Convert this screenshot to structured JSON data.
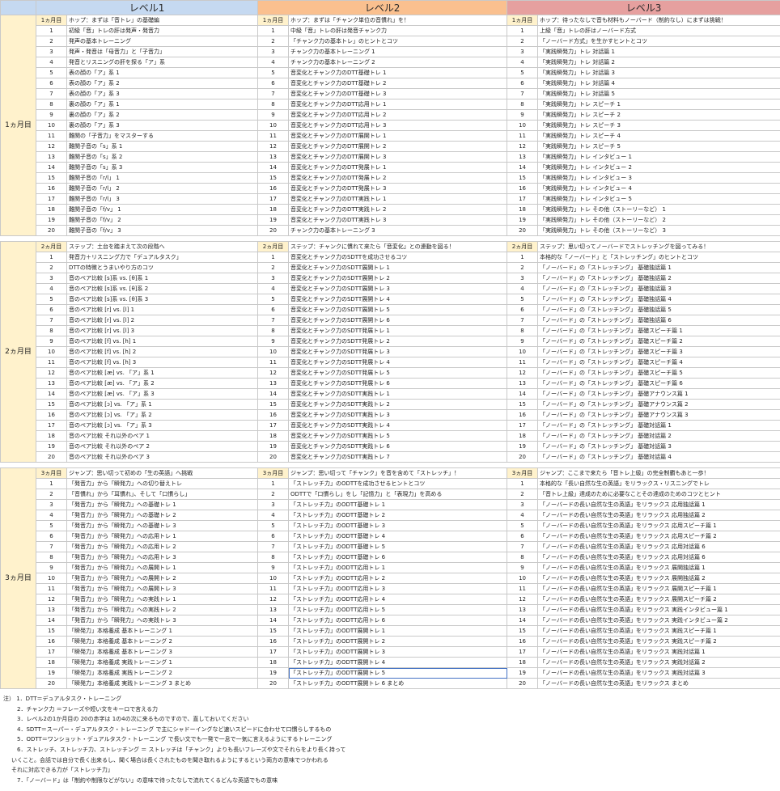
{
  "levels": [
    "レベル1",
    "レベル2",
    "レベル3"
  ],
  "sections": [
    {
      "month_label": "1ヵ月目",
      "cols": [
        {
          "month": "1ヵ月目",
          "title": "ホップ：まずは「音トレ」の基礎編",
          "items": [
            "初級「音」トレの肝は発声・発音力",
            "発声の基本トレーニング",
            "発声・発音は「母音力」と「子音力」",
            "発音とリスニングの肝を探る「ア」系",
            "表の顔の「ア」系 1",
            "表の顔の「ア」系 2",
            "表の顔の「ア」系 3",
            "裏の顔の「ア」系 1",
            "裏の顔の「ア」系 2",
            "裏の顔の「ア」系 3",
            "難関の「子音力」をマスターする",
            "難関子音の「s」系 1",
            "難関子音の「s」系 2",
            "難関子音の「s」系 3",
            "難関子音の「r/l」 1",
            "難関子音の「r/l」 2",
            "難関子音の「r/l」 3",
            "難関子音の「f/v」 1",
            "難関子音の「f/v」 2",
            "難関子音の「f/v」 3"
          ]
        },
        {
          "month": "1ヵ月目",
          "title": "ホップ：まずは「チャンク単位の音慣れ」を！",
          "items": [
            "中級「音」トレの肝は発音チャンク力",
            "「チャンク力の基本トレ」のヒントとコツ",
            "チャンク力の基本トレーニング 1",
            "チャンク力の基本トレーニング 2",
            "音変化とチャンク力のDTT基礎トレ 1",
            "音変化とチャンク力のDTT基礎トレ 2",
            "音変化とチャンク力のDTT基礎トレ 3",
            "音変化とチャンク力のDTT応用トレ 1",
            "音変化とチャンク力のDTT応用トレ 2",
            "音変化とチャンク力のDTT応用トレ 3",
            "音変化とチャンク力のDTT展開トレ 1",
            "音変化とチャンク力のDTT展開トレ 2",
            "音変化とチャンク力のDTT展開トレ 3",
            "音変化とチャンク力のDTT発展トレ 1",
            "音変化とチャンク力のDTT発展トレ 2",
            "音変化とチャンク力のDTT発展トレ 3",
            "音変化とチャンク力のDTT実践トレ 1",
            "音変化とチャンク力のDTT実践トレ 2",
            "音変化とチャンク力のDTT実践トレ 3",
            "チャンク力の基本トレーニング 3"
          ]
        },
        {
          "month": "1ヵ月目",
          "title": "ホップ：待ったなしで音も材料もノーバード（制約なし）にまずは挑戦！",
          "items": [
            "上級「音」トレの肝はノーバード方式",
            "「ノーバード方式」を生かすヒントとコツ",
            "「実践瞬発力」トレ 対話篇 1",
            "「実践瞬発力」トレ 対話篇 2",
            "「実践瞬発力」トレ 対話篇 3",
            "「実践瞬発力」トレ 対話篇 4",
            "「実践瞬発力」トレ 対話篇 5",
            "「実践瞬発力」トレ スピーチ 1",
            "「実践瞬発力」トレ スピーチ 2",
            "「実践瞬発力」トレ スピーチ 3",
            "「実践瞬発力」トレ スピーチ 4",
            "「実践瞬発力」トレ スピーチ 5",
            "「実践瞬発力」トレ インタビュー 1",
            "「実践瞬発力」トレ インタビュー 2",
            "「実践瞬発力」トレ インタビュー 3",
            "「実践瞬発力」トレ インタビュー 4",
            "「実践瞬発力」トレ インタビュー 5",
            "「実践瞬発力」トレ その他（ストーリーなど） 1",
            "「実践瞬発力」トレ その他（ストーリーなど） 2",
            "「実践瞬発力」トレ その他（ストーリーなど） 3"
          ]
        }
      ]
    },
    {
      "month_label": "2ヵ月目",
      "cols": [
        {
          "month": "2ヵ月目",
          "title": "ステップ：土台を踏まえて次の段階へ",
          "items": [
            "発音力＋リスニング力で「デュアルタスク」",
            "DTTの特徴とうまいやり方のコツ",
            "音のペア比較 [s]系 vs. [θ]系 1",
            "音のペア比較 [s]系 vs. [θ]系 2",
            "音のペア比較 [s]系 vs. [θ]系 3",
            "音のペア比較 [r] vs. [l] 1",
            "音のペア比較 [r] vs. [l] 2",
            "音のペア比較 [r] vs. [l] 3",
            "音のペア比較 [f] vs. [h] 1",
            "音のペア比較 [f] vs. [h] 2",
            "音のペア比較 [f] vs. [h] 3",
            "音のペア比較 [æ] vs. 「ア」系 1",
            "音のペア比較 [æ] vs. 「ア」系 2",
            "音のペア比較 [æ] vs. 「ア」系 3",
            "音のペア比較 [ɔ] vs. 「ア」系 1",
            "音のペア比較 [ɔ] vs. 「ア」系 2",
            "音のペア比較 [ɔ] vs. 「ア」系 3",
            "音のペア比較 それ以外のペア 1",
            "音のペア比較 それ以外のペア 2",
            "音のペア比較 それ以外のペア 3"
          ]
        },
        {
          "month": "2ヵ月目",
          "title": "ステップ：チャンクに慣れて来たら「音変化」との連動を図る！",
          "items": [
            "音変化とチャンク力のSDTTを成功させるコツ",
            "音変化とチャンク力のSDTT展開トレ 1",
            "音変化とチャンク力のSDTT展開トレ 2",
            "音変化とチャンク力のSDTT展開トレ 3",
            "音変化とチャンク力のSDTT展開トレ 4",
            "音変化とチャンク力のSDTT展開トレ 5",
            "音変化とチャンク力のSDTT展開トレ 6",
            "音変化とチャンク力のSDTT発展トレ 1",
            "音変化とチャンク力のSDTT発展トレ 2",
            "音変化とチャンク力のSDTT発展トレ 3",
            "音変化とチャンク力のSDTT発展トレ 4",
            "音変化とチャンク力のSDTT発展トレ 5",
            "音変化とチャンク力のSDTT発展トレ 6",
            "音変化とチャンク力のSDTT実践トレ 1",
            "音変化とチャンク力のSDTT実践トレ 2",
            "音変化とチャンク力のSDTT実践トレ 3",
            "音変化とチャンク力のSDTT実践トレ 4",
            "音変化とチャンク力のSDTT実践トレ 5",
            "音変化とチャンク力のSDTT実践トレ 6",
            "音変化とチャンク力のSDTT実践トレ 7"
          ]
        },
        {
          "month": "2ヵ月目",
          "title": "ステップ：思い切ってノーバードでストレッチングを図ってみる！",
          "items": [
            "本格的な「ノーバード」と「ストレッチング」のヒントとコツ",
            "「ノーバード」の「ストレッチング」 基礎独話篇 1",
            "「ノーバード」の「ストレッチング」 基礎独話篇 2",
            "「ノーバード」の「ストレッチング」 基礎独話篇 3",
            "「ノーバード」の「ストレッチング」 基礎独話篇 4",
            "「ノーバード」の「ストレッチング」 基礎独話篇 5",
            "「ノーバード」の「ストレッチング」 基礎独話篇 6",
            "「ノーバード」の「ストレッチング」 基礎スピーチ篇 1",
            "「ノーバード」の「ストレッチング」 基礎スピーチ篇 2",
            "「ノーバード」の「ストレッチング」 基礎スピーチ篇 3",
            "「ノーバード」の「ストレッチング」 基礎スピーチ篇 4",
            "「ノーバード」の「ストレッチング」 基礎スピーチ篇 5",
            "「ノーバード」の「ストレッチング」 基礎スピーチ篇 6",
            "「ノーバード」の「ストレッチング」 基礎アナウンス篇 1",
            "「ノーバード」の「ストレッチング」 基礎アナウンス篇 2",
            "「ノーバード」の「ストレッチング」 基礎アナウンス篇 3",
            "「ノーバード」の「ストレッチング」 基礎対話篇 1",
            "「ノーバード」の「ストレッチング」 基礎対話篇 2",
            "「ノーバード」の「ストレッチング」 基礎対話篇 3",
            "「ノーバード」の「ストレッチング」 基礎対話篇 4"
          ]
        }
      ]
    },
    {
      "month_label": "3ヵ月目",
      "cols": [
        {
          "month": "3ヵ月目",
          "title": "ジャンプ：思い切って初めの「生の英語」へ挑戦",
          "items": [
            "「発音力」から「瞬発力」への切り替えトレ",
            "「音慣れ」から「耳慣れ」、そして「口慣らし」",
            "「発音力」から「瞬発力」への基礎トレ 1",
            "「発音力」から「瞬発力」への基礎トレ 2",
            "「発音力」から「瞬発力」への基礎トレ 3",
            "「発音力」から「瞬発力」への応用トレ 1",
            "「発音力」から「瞬発力」への応用トレ 2",
            "「発音力」から「瞬発力」への応用トレ 3",
            "「発音力」から「瞬発力」への展開トレ 1",
            "「発音力」から「瞬発力」への展開トレ 2",
            "「発音力」から「瞬発力」への展開トレ 3",
            "「発音力」から「瞬発力」への実践トレ 1",
            "「発音力」から「瞬発力」への実践トレ 2",
            "「発音力」から「瞬発力」への実践トレ 3",
            "「瞬発力」本格養成 基本トレーニング 1",
            "「瞬発力」本格養成 基本トレーニング 2",
            "「瞬発力」本格養成 基本トレーニング 3",
            "「瞬発力」本格養成 実践トレーニング 1",
            "「瞬発力」本格養成 実践トレーニング 2",
            "「瞬発力」本格養成 実践トレーニング 3 まとめ"
          ]
        },
        {
          "month": "3ヵ月目",
          "title": "ジャンプ：思い切って「チャンク」を音を含めて「ストレッチ」！",
          "items": [
            "「ストレッチ力」のODTTを成功させるヒントとコツ",
            "ODTTで「口慣らし」をし「記憶力」と「表現力」を高める",
            "「ストレッチ力」のODTT基礎トレ 1",
            "「ストレッチ力」のODTT基礎トレ 2",
            "「ストレッチ力」のODTT基礎トレ 3",
            "「ストレッチ力」のODTT基礎トレ 4",
            "「ストレッチ力」のODTT基礎トレ 5",
            "「ストレッチ力」のODTT基礎トレ 6",
            "「ストレッチ力」のODTT応用トレ 1",
            "「ストレッチ力」のODTT応用トレ 2",
            "「ストレッチ力」のODTT応用トレ 3",
            "「ストレッチ力」のODTT応用トレ 4",
            "「ストレッチ力」のODTT応用トレ 5",
            "「ストレッチ力」のODTT応用トレ 6",
            "「ストレッチ力」のODTT展開トレ 1",
            "「ストレッチ力」のODTT展開トレ 2",
            "「ストレッチ力」のODTT展開トレ 3",
            "「ストレッチ力」のODTT展開トレ 4",
            "「ストレッチ力」のODTT展開トレ 5",
            "「ストレッチ力」のODTT展開トレ 6 まとめ"
          ]
        },
        {
          "month": "3ヵ月目",
          "title": "ジャンプ：ここまで来たら「音トレ上級」の完全制覇もあと一歩！",
          "items": [
            "本格的な「長い自然な生の英語」をリラックス・リスニングでトレ",
            "「音トレ上級」達成のために必要なことその達成のためのコツとヒント",
            "「ノーバードの長い自然な生の英語」をリラックス 応用独話篇 1",
            "「ノーバードの長い自然な生の英語」をリラックス 応用独話篇 2",
            "「ノーバードの長い自然な生の英語」をリラックス 応用スピーチ篇 1",
            "「ノーバードの長い自然な生の英語」をリラックス 応用スピーチ篇 2",
            "「ノーバードの長い自然な生の英語」をリラックス 応用対話篇 6",
            "「ノーバードの長い自然な生の英語」をリラックス 応用対話篇 6",
            "「ノーバードの長い自然な生の英語」をリラックス 展開独話篇 1",
            "「ノーバードの長い自然な生の英語」をリラックス 展開独話篇 2",
            "「ノーバードの長い自然な生の英語」をリラックス 展開スピーチ篇 1",
            "「ノーバードの長い自然な生の英語」をリラックス 展開スピーチ篇 2",
            "「ノーバードの長い自然な生の英語」をリラックス 実践インタビュー篇 1",
            "「ノーバードの長い自然な生の英語」をリラックス 実践インタビュー篇 2",
            "「ノーバードの長い自然な生の英語」をリラックス 実践スピーチ篇 1",
            "「ノーバードの長い自然な生の英語」をリラックス 実践スピーチ篇 2",
            "「ノーバードの長い自然な生の英語」をリラックス 実践対話篇 1",
            "「ノーバードの長い自然な生の英語」をリラックス 実践対話篇 2",
            "「ノーバードの長い自然な生の英語」をリラックス 実践対話篇 3",
            "「ノーバードの長い自然な生の英語」をリラックス まとめ"
          ]
        }
      ]
    }
  ],
  "notes": [
    "注） 1．DTT＝デュアルタスク・トレーニング",
    "2．チャンク力 ＝フレーズや短い文をキーロで言える力",
    "3．レベル2の1か月目の 20の赤字は 1の4の次に来るものですので、直しておいてください",
    "4．SDTT＝スーパー・デュアルタスク・トレーニング で主にシャドーイングなど速いスピードに合わせて口慣らしするもの",
    "5．ODTT＝ワンショット・デュアルタスク・トレーニング で長い文でも一発で一息で一気に言えるようにするトレーニング",
    "6．ストレッチ、ストレッチ力、ストレッチング ＝ ストレッチは「チャンク」よりも長いフレーズや文でそれらをより長く持って",
    "いくこと。会話では自分で長く出来るし、聞く場合は長くされたものを聞き取れるようにするという両方の意味でつかわれる",
    "それに対応できる力が「ストレッチ力」",
    "7．「ノーバード」は「制約や制限などがない」の意味で待ったなしで流れてくるどんな英語でもの意味"
  ],
  "colors": {
    "level1": "#c5d9f1",
    "level2": "#fac08f",
    "level3": "#e6a09f",
    "month": "#fff2cc"
  }
}
